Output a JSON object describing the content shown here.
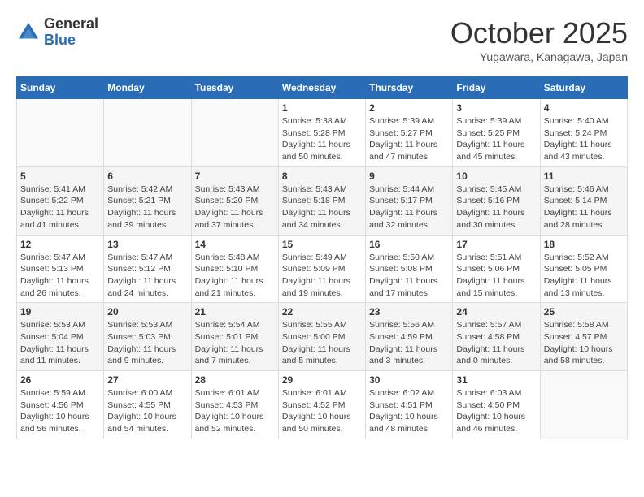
{
  "header": {
    "logo_general": "General",
    "logo_blue": "Blue",
    "month_title": "October 2025",
    "subtitle": "Yugawara, Kanagawa, Japan"
  },
  "weekdays": [
    "Sunday",
    "Monday",
    "Tuesday",
    "Wednesday",
    "Thursday",
    "Friday",
    "Saturday"
  ],
  "weeks": [
    [
      {
        "day": "",
        "info": ""
      },
      {
        "day": "",
        "info": ""
      },
      {
        "day": "",
        "info": ""
      },
      {
        "day": "1",
        "info": "Sunrise: 5:38 AM\nSunset: 5:28 PM\nDaylight: 11 hours\nand 50 minutes."
      },
      {
        "day": "2",
        "info": "Sunrise: 5:39 AM\nSunset: 5:27 PM\nDaylight: 11 hours\nand 47 minutes."
      },
      {
        "day": "3",
        "info": "Sunrise: 5:39 AM\nSunset: 5:25 PM\nDaylight: 11 hours\nand 45 minutes."
      },
      {
        "day": "4",
        "info": "Sunrise: 5:40 AM\nSunset: 5:24 PM\nDaylight: 11 hours\nand 43 minutes."
      }
    ],
    [
      {
        "day": "5",
        "info": "Sunrise: 5:41 AM\nSunset: 5:22 PM\nDaylight: 11 hours\nand 41 minutes."
      },
      {
        "day": "6",
        "info": "Sunrise: 5:42 AM\nSunset: 5:21 PM\nDaylight: 11 hours\nand 39 minutes."
      },
      {
        "day": "7",
        "info": "Sunrise: 5:43 AM\nSunset: 5:20 PM\nDaylight: 11 hours\nand 37 minutes."
      },
      {
        "day": "8",
        "info": "Sunrise: 5:43 AM\nSunset: 5:18 PM\nDaylight: 11 hours\nand 34 minutes."
      },
      {
        "day": "9",
        "info": "Sunrise: 5:44 AM\nSunset: 5:17 PM\nDaylight: 11 hours\nand 32 minutes."
      },
      {
        "day": "10",
        "info": "Sunrise: 5:45 AM\nSunset: 5:16 PM\nDaylight: 11 hours\nand 30 minutes."
      },
      {
        "day": "11",
        "info": "Sunrise: 5:46 AM\nSunset: 5:14 PM\nDaylight: 11 hours\nand 28 minutes."
      }
    ],
    [
      {
        "day": "12",
        "info": "Sunrise: 5:47 AM\nSunset: 5:13 PM\nDaylight: 11 hours\nand 26 minutes."
      },
      {
        "day": "13",
        "info": "Sunrise: 5:47 AM\nSunset: 5:12 PM\nDaylight: 11 hours\nand 24 minutes."
      },
      {
        "day": "14",
        "info": "Sunrise: 5:48 AM\nSunset: 5:10 PM\nDaylight: 11 hours\nand 21 minutes."
      },
      {
        "day": "15",
        "info": "Sunrise: 5:49 AM\nSunset: 5:09 PM\nDaylight: 11 hours\nand 19 minutes."
      },
      {
        "day": "16",
        "info": "Sunrise: 5:50 AM\nSunset: 5:08 PM\nDaylight: 11 hours\nand 17 minutes."
      },
      {
        "day": "17",
        "info": "Sunrise: 5:51 AM\nSunset: 5:06 PM\nDaylight: 11 hours\nand 15 minutes."
      },
      {
        "day": "18",
        "info": "Sunrise: 5:52 AM\nSunset: 5:05 PM\nDaylight: 11 hours\nand 13 minutes."
      }
    ],
    [
      {
        "day": "19",
        "info": "Sunrise: 5:53 AM\nSunset: 5:04 PM\nDaylight: 11 hours\nand 11 minutes."
      },
      {
        "day": "20",
        "info": "Sunrise: 5:53 AM\nSunset: 5:03 PM\nDaylight: 11 hours\nand 9 minutes."
      },
      {
        "day": "21",
        "info": "Sunrise: 5:54 AM\nSunset: 5:01 PM\nDaylight: 11 hours\nand 7 minutes."
      },
      {
        "day": "22",
        "info": "Sunrise: 5:55 AM\nSunset: 5:00 PM\nDaylight: 11 hours\nand 5 minutes."
      },
      {
        "day": "23",
        "info": "Sunrise: 5:56 AM\nSunset: 4:59 PM\nDaylight: 11 hours\nand 3 minutes."
      },
      {
        "day": "24",
        "info": "Sunrise: 5:57 AM\nSunset: 4:58 PM\nDaylight: 11 hours\nand 0 minutes."
      },
      {
        "day": "25",
        "info": "Sunrise: 5:58 AM\nSunset: 4:57 PM\nDaylight: 10 hours\nand 58 minutes."
      }
    ],
    [
      {
        "day": "26",
        "info": "Sunrise: 5:59 AM\nSunset: 4:56 PM\nDaylight: 10 hours\nand 56 minutes."
      },
      {
        "day": "27",
        "info": "Sunrise: 6:00 AM\nSunset: 4:55 PM\nDaylight: 10 hours\nand 54 minutes."
      },
      {
        "day": "28",
        "info": "Sunrise: 6:01 AM\nSunset: 4:53 PM\nDaylight: 10 hours\nand 52 minutes."
      },
      {
        "day": "29",
        "info": "Sunrise: 6:01 AM\nSunset: 4:52 PM\nDaylight: 10 hours\nand 50 minutes."
      },
      {
        "day": "30",
        "info": "Sunrise: 6:02 AM\nSunset: 4:51 PM\nDaylight: 10 hours\nand 48 minutes."
      },
      {
        "day": "31",
        "info": "Sunrise: 6:03 AM\nSunset: 4:50 PM\nDaylight: 10 hours\nand 46 minutes."
      },
      {
        "day": "",
        "info": ""
      }
    ]
  ]
}
